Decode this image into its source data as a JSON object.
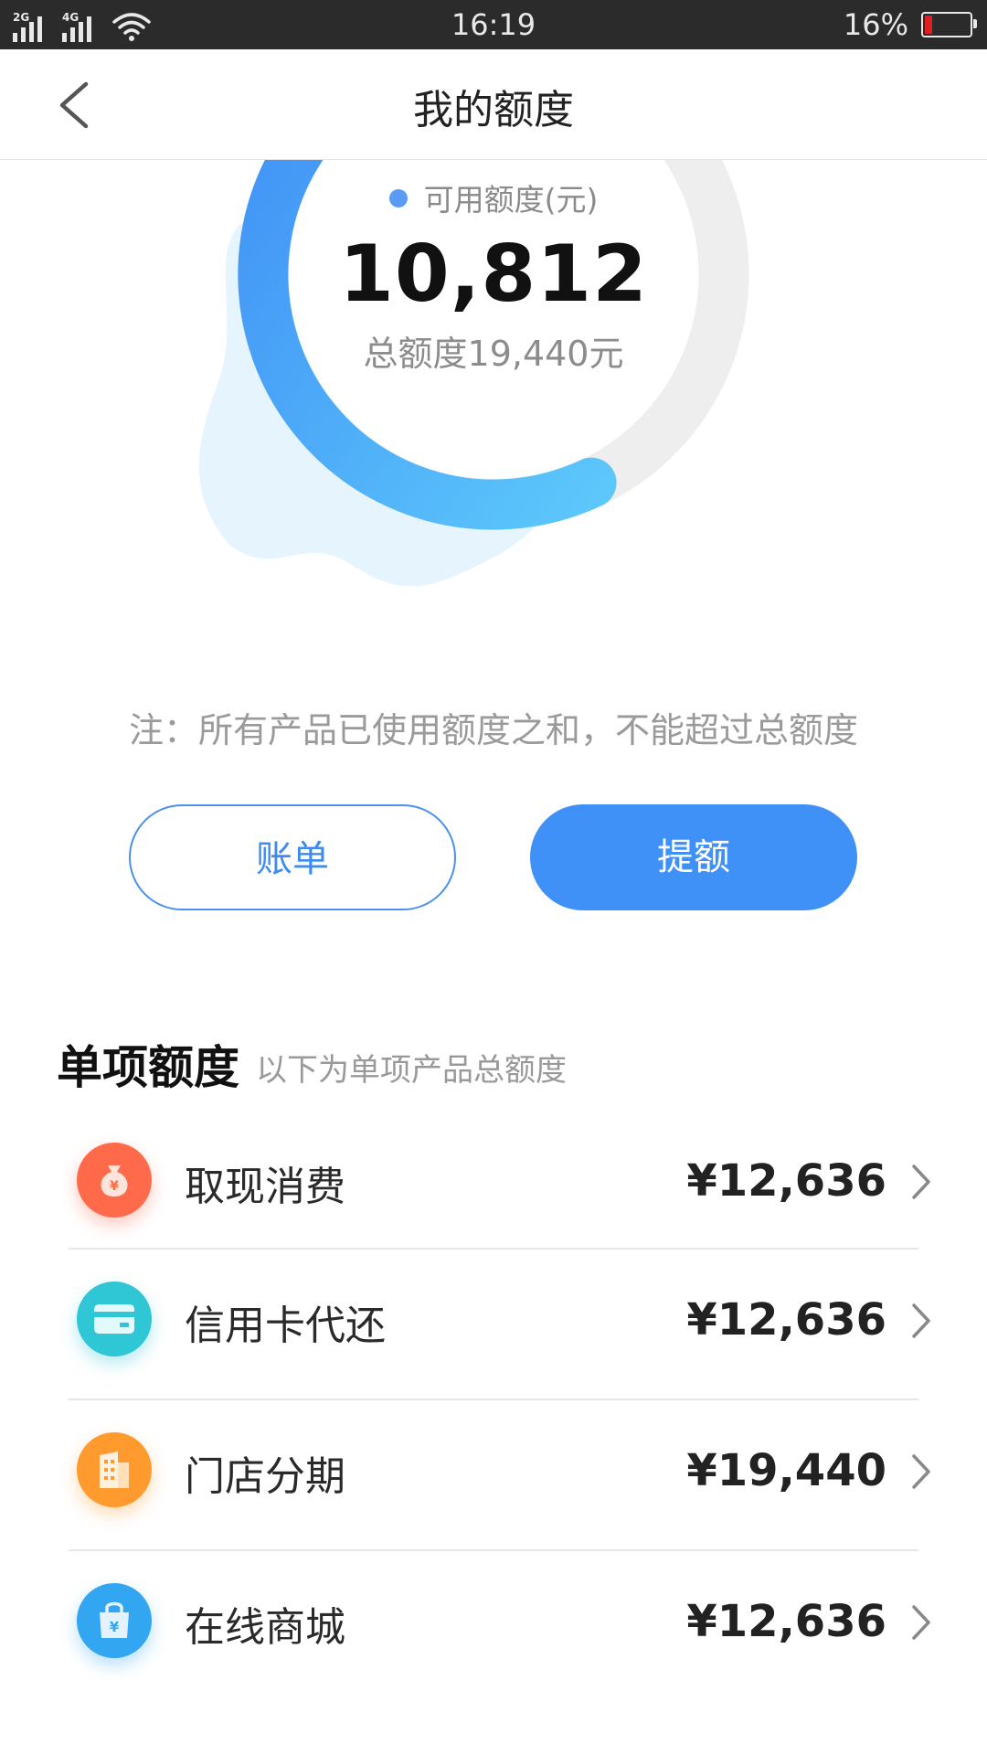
{
  "status_bar": {
    "network1": "2G",
    "network2": "4G",
    "time": "16:19",
    "battery": "16%",
    "battery_color": "#e02020"
  },
  "nav": {
    "title": "我的额度",
    "back_icon": "chevron-left-icon"
  },
  "quota": {
    "available_label": "可用额度(元)",
    "available_value": "10,812",
    "total_label": "总额度19,440元",
    "available_fraction": 0.556
  },
  "note": "注：所有产品已使用额度之和，不能超过总额度",
  "buttons": {
    "bill": "账单",
    "raise": "提额"
  },
  "section": {
    "title": "单项额度",
    "subtitle": "以下为单项产品总额度"
  },
  "items": [
    {
      "label": "取现消费",
      "amount": "¥12,636",
      "icon": "money-bag-icon",
      "color": "#ff6a4a"
    },
    {
      "label": "信用卡代还",
      "amount": "¥12,636",
      "icon": "credit-card-icon",
      "color": "#2fc6d6"
    },
    {
      "label": "门店分期",
      "amount": "¥19,440",
      "icon": "store-building-icon",
      "color": "#ff9a2e"
    },
    {
      "label": "在线商城",
      "amount": "¥12,636",
      "icon": "shopping-bag-icon",
      "color": "#33a6f2"
    }
  ],
  "colors": {
    "accent": "#3f91f8",
    "gauge_track": "#eeeeee"
  }
}
